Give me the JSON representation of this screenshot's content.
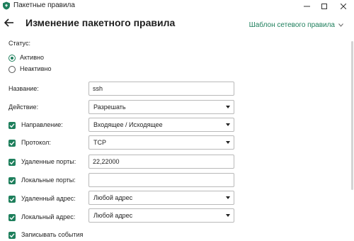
{
  "window": {
    "title": "Пакетные правила",
    "minimize": "—",
    "maximize": "☐",
    "close": "✕"
  },
  "header": {
    "title": "Изменение пакетного правила",
    "template_link": "Шаблон сетевого правила",
    "template_chevron": "⌄"
  },
  "status": {
    "label": "Статус:",
    "options": [
      {
        "label": "Активно",
        "checked": true
      },
      {
        "label": "Неактивно",
        "checked": false
      }
    ]
  },
  "form": {
    "name": {
      "label": "Название:",
      "value": "ssh"
    },
    "action": {
      "label": "Действие:",
      "value": "Разрешать"
    },
    "direction": {
      "label": "Направление:",
      "value": "Входящее / Исходящее",
      "enabled": true
    },
    "protocol": {
      "label": "Протокол:",
      "value": "TCP",
      "enabled": true
    },
    "remote_ports": {
      "label": "Удаленные порты:",
      "value": "22,22000",
      "enabled": true
    },
    "local_ports": {
      "label": "Локальные порты:",
      "value": "",
      "enabled": true
    },
    "remote_address": {
      "label": "Удаленный адрес:",
      "value": "Любой адрес",
      "enabled": true
    },
    "local_address": {
      "label": "Локальный адрес:",
      "value": "Любой адрес",
      "enabled": true
    },
    "log_events": {
      "label": "Записывать события",
      "enabled": true
    }
  },
  "colors": {
    "accent": "#1e7f5c",
    "field_border": "#b9b9b9",
    "text": "#1f1f1f"
  }
}
